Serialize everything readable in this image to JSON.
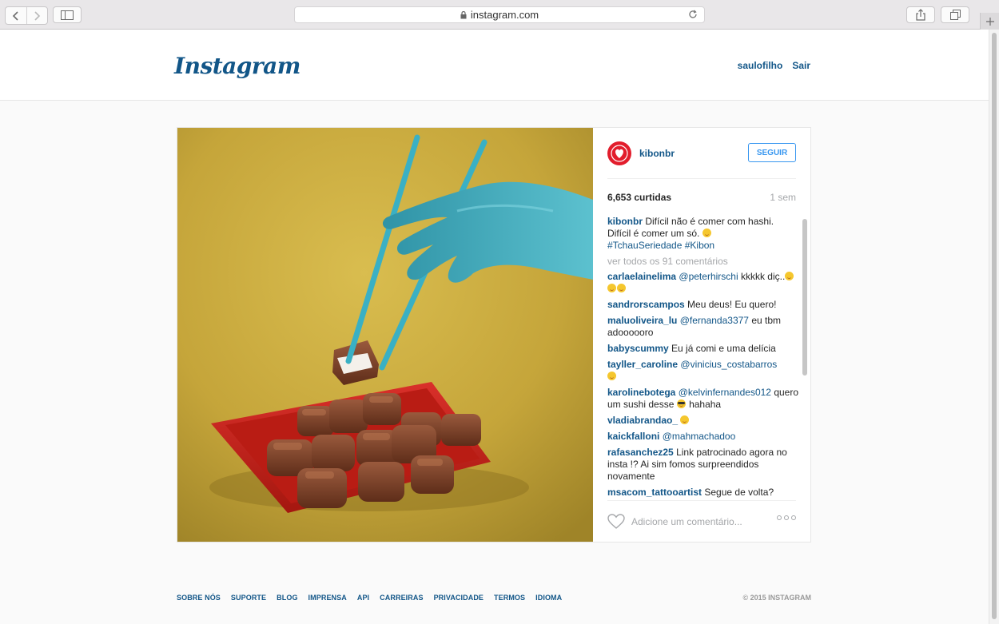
{
  "browser": {
    "url": "instagram.com"
  },
  "header": {
    "logo": "Instagram",
    "username": "saulofilho",
    "logout": "Sair"
  },
  "post": {
    "owner": "kibonbr",
    "follow_label": "SEGUIR",
    "likes": "6,653 curtidas",
    "age": "1 sem",
    "caption": {
      "author": "kibonbr",
      "text": "Difícil não é comer com hashi. Difícil é comer um só.",
      "hashtags": "#TchauSeriedade #Kibon"
    },
    "view_all": "ver todos os 91 comentários",
    "comments": [
      {
        "author": "carlaelainelima",
        "mention": "@peterhirschi",
        "text": "kkkkk diç..",
        "emoji": 3
      },
      {
        "author": "sandrorscampos",
        "mention": "",
        "text": "Meu deus! Eu quero!",
        "emoji": 0
      },
      {
        "author": "maluoliveira_lu",
        "mention": "@fernanda3377",
        "text": "eu tbm adoooooro",
        "emoji": 0
      },
      {
        "author": "babyscummy",
        "mention": "",
        "text": "Eu já comi e uma delícia",
        "emoji": 0
      },
      {
        "author": "tayller_caroline",
        "mention": "@vinicius_costabarros",
        "text": "",
        "emoji": 1
      },
      {
        "author": "karolinebotega",
        "mention": "@kelvinfernandes012",
        "text": "quero um sushi desse",
        "after_emoji": "hahaha"
      },
      {
        "author": "vladiabrandao_",
        "mention": "",
        "text": "",
        "emoji": 1
      },
      {
        "author": "kaickfalloni",
        "mention": "@mahmachadoo",
        "text": "",
        "emoji": 0
      },
      {
        "author": "rafasanchez25",
        "mention": "",
        "text": "Link patrocinado agora no insta !? Ai sim fomos surpreendidos novamente",
        "emoji": 0
      },
      {
        "author": "msacom_tattooartist",
        "mention": "",
        "text": "Segue de volta?",
        "emoji": 0
      }
    ],
    "comment_placeholder": "Adicione um comentário..."
  },
  "footer": {
    "links": [
      "SOBRE NÓS",
      "SUPORTE",
      "BLOG",
      "IMPRENSA",
      "API",
      "CARREIRAS",
      "PRIVACIDADE",
      "TERMOS",
      "IDIOMA"
    ],
    "copyright": "© 2015 INSTAGRAM"
  },
  "colors": {
    "link_blue": "#125688",
    "follow_blue": "#3897f0",
    "photo_bg": "#c9a93a",
    "plate_red": "#c8231c",
    "hand_teal": "#3aa5b5",
    "chocolate": "#7a3f26"
  }
}
